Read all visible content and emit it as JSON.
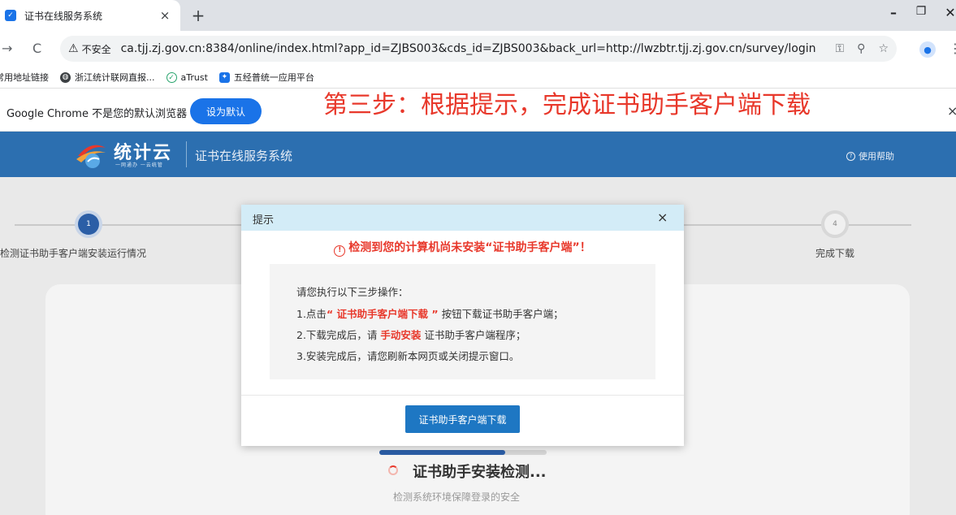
{
  "browser": {
    "tab_title": "证书在线服务系统",
    "tab_close": "×",
    "new_tab": "+",
    "win_minimize": "–",
    "win_restore": "❐",
    "win_close": "✕",
    "back": "→",
    "reload": "C",
    "not_secure": "不安全",
    "url": "ca.tjj.zj.gov.cn:8384/online/index.html?app_id=ZJBS003&cds_id=ZJBS003&back_url=http://lwzbtr.tjj.zj.gov.cn/survey/login"
  },
  "bookmarks": [
    {
      "label": "常用地址链接",
      "icon": "none"
    },
    {
      "label": "浙江统计联网直报...",
      "icon": "globe-icon"
    },
    {
      "label": "aTrust",
      "icon": "atrust-icon"
    },
    {
      "label": "五经普统一应用平台",
      "icon": "feather-icon"
    }
  ],
  "infobar": {
    "text": "Google Chrome 不是您的默认浏览器",
    "button": "设为默认",
    "close": "×"
  },
  "annotation": "第三步：根据提示，完成证书助手客户端下载",
  "site": {
    "logo_text": "统计云",
    "logo_sub": "一网通办 一云统管",
    "system_title": "证书在线服务系统",
    "help": "使用帮助"
  },
  "steps": [
    {
      "num": "1",
      "label": "检测证书助手客户端安装运行情况",
      "active": true
    },
    {
      "num": "4",
      "label": "完成下载",
      "active": false
    }
  ],
  "detect": {
    "progress": 0.75,
    "title": "证书助手安装检测...",
    "subtitle": "检测系统环境保障登录的安全"
  },
  "modal": {
    "title": "提示",
    "close": "×",
    "alert": "检测到您的计算机尚未安装“证书助手客户端”！",
    "intro": "请您执行以下三步操作：",
    "step1_pre": "1.点击",
    "step1_hl": "“ 证书助手客户端下载 ”",
    "step1_post": "按钮下载证书助手客户端；",
    "step2_pre": "2.下载完成后，请",
    "step2_hl": "手动安装",
    "step2_post": "证书助手客户端程序；",
    "step3": "3.安装完成后，请您刷新本网页或关闭提示窗口。",
    "button": "证书助手客户端下载"
  },
  "colors": {
    "header_blue": "#2c6fb0",
    "accent_red": "#e8382b",
    "button_blue": "#1e77c3",
    "modal_header": "#d3ecf7"
  }
}
